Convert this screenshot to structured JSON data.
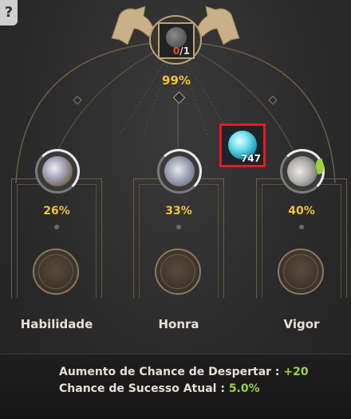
{
  "help": {
    "label": "?"
  },
  "center": {
    "current": "0",
    "total": "/1",
    "chance": "99%"
  },
  "material": {
    "quantity": "747"
  },
  "stats": [
    {
      "name": "Habilidade",
      "percent": "26%"
    },
    {
      "name": "Honra",
      "percent": "33%"
    },
    {
      "name": "Vigor",
      "percent": "40%"
    }
  ],
  "info": {
    "bonus_label": "Aumento de Chance de Despertar :",
    "bonus_value": "+20",
    "success_label": "Chance de Sucesso Atual :",
    "success_value": "5.0%"
  },
  "colors": {
    "accent_gold": "#f2c23a",
    "value_green": "#9bd43c",
    "highlight_red": "#e01e24",
    "frame": "#b9a27a"
  },
  "icons": {
    "center": "skull-icon",
    "material": "blue-orb-icon",
    "crest": "horse-crest-icon"
  }
}
